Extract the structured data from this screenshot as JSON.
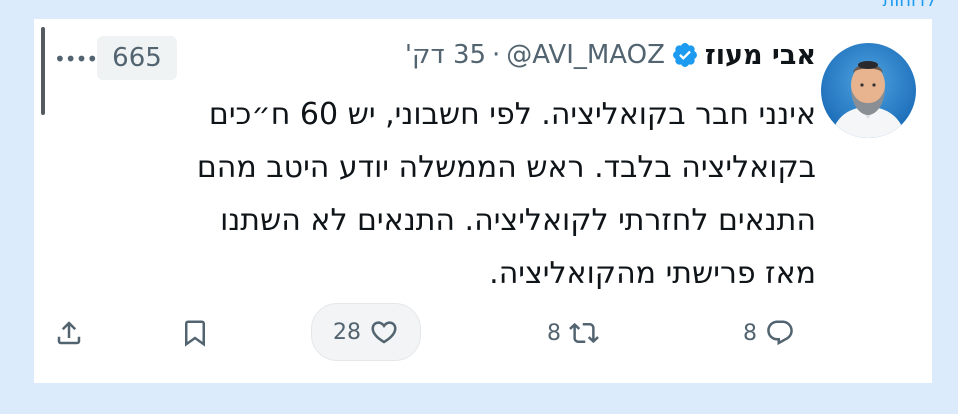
{
  "top_link": "לדוחות",
  "tweet": {
    "author_name": "אבי מעוז",
    "handle": "@AVI_MAOZ",
    "separator": "·",
    "time": "35 דק'",
    "views": "665",
    "text": "אינני חבר בקואליציה. לפי חשבוני, יש 60 ח״כים\nבקואליציה בלבד. ראש הממשלה יודע היטב מהם\nהתנאים לחזרתי לקואליציה. התנאים לא השתנו\nמאז פרישתי מהקואליציה.",
    "replies": "8",
    "retweets": "8",
    "likes": "28"
  },
  "icons": {
    "verified": "verified-badge-icon",
    "more": "more-options-icon",
    "reply": "reply-icon",
    "retweet": "retweet-icon",
    "like": "heart-icon",
    "bookmark": "bookmark-icon",
    "share": "share-icon"
  },
  "colors": {
    "background": "#dcebfb",
    "card": "#ffffff",
    "accent": "#1d9bf0",
    "muted": "#536471",
    "text": "#0f1419"
  }
}
